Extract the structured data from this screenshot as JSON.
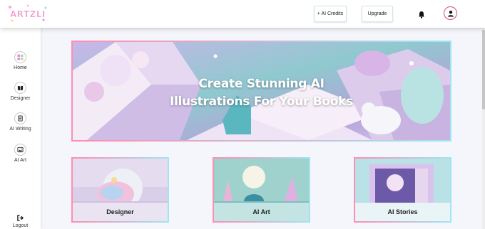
{
  "header": {
    "logo_text": "ARTZLI",
    "credits_label": "+ AI Credits",
    "upgrade_label": "Upgrade",
    "bell_icon": "bell-icon",
    "avatar_icon": "user-icon"
  },
  "sidebar": {
    "items": [
      {
        "label": "Home",
        "icon": "grid-icon"
      },
      {
        "label": "Designer",
        "icon": "book-icon"
      },
      {
        "label": "AI Writing",
        "icon": "document-icon"
      },
      {
        "label": "AI Art",
        "icon": "image-icon"
      }
    ],
    "logout_label": "Logout"
  },
  "hero": {
    "line1": "Create Stunning AI",
    "line2": "Illustrations For Your Books"
  },
  "cards": [
    {
      "label": "Designer"
    },
    {
      "label": "AI Art"
    },
    {
      "label": "AI Stories"
    }
  ],
  "colors": {
    "accent_pink": "#e0457b",
    "border_gradient_start": "#ff8db3",
    "border_gradient_end": "#9ee6f0"
  }
}
